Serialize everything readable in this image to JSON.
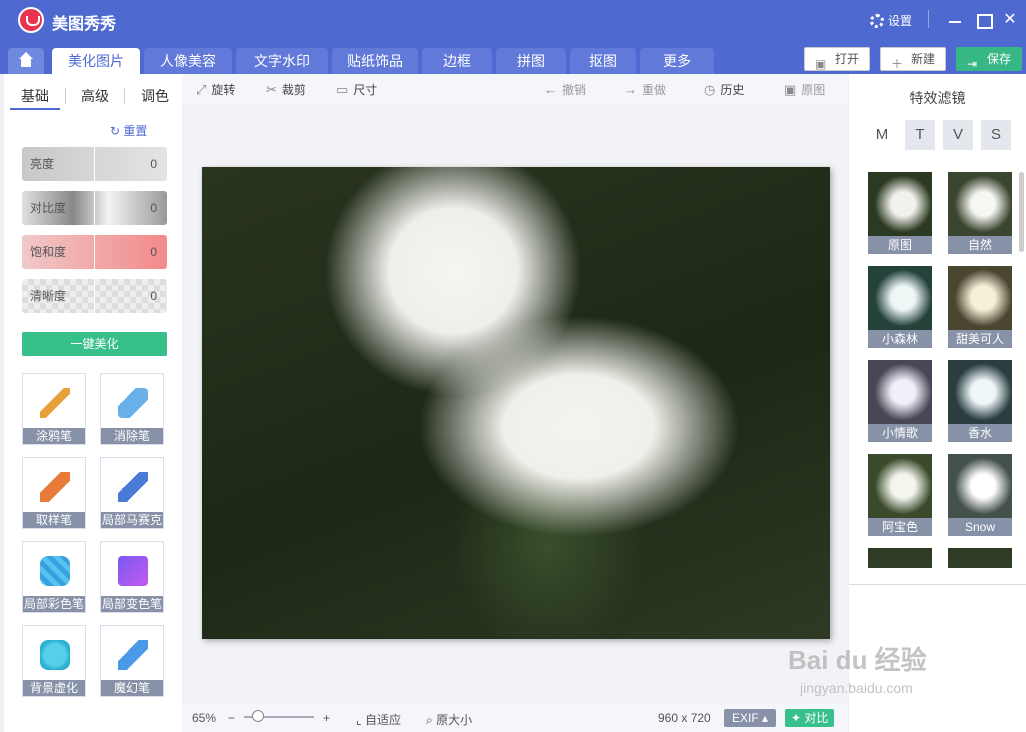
{
  "app": {
    "title": "美图秀秀",
    "settings_label": "设置",
    "close_glyph": "✕"
  },
  "tabs": [
    "美化图片",
    "人像美容",
    "文字水印",
    "贴纸饰品",
    "边框",
    "拼图",
    "抠图",
    "更多"
  ],
  "top_buttons": {
    "open": "打开",
    "new": "新建",
    "save": "保存"
  },
  "left_panel": {
    "subtabs": [
      "基础",
      "高级",
      "调色"
    ],
    "reset": "重置",
    "sliders": [
      {
        "label": "亮度",
        "value": "0"
      },
      {
        "label": "对比度",
        "value": "0"
      },
      {
        "label": "饱和度",
        "value": "0"
      },
      {
        "label": "清晰度",
        "value": "0"
      }
    ],
    "beautify": "一键美化",
    "tools": [
      {
        "label": "涂鸦笔",
        "icon": "brush-icon"
      },
      {
        "label": "消除笔",
        "icon": "eraser-icon"
      },
      {
        "label": "取样笔",
        "icon": "sampling-brush-icon"
      },
      {
        "label": "局部马赛克",
        "icon": "mosaic-brush-icon"
      },
      {
        "label": "局部彩色笔",
        "icon": "color-brush-icon"
      },
      {
        "label": "局部变色笔",
        "icon": "color-change-icon"
      },
      {
        "label": "背景虚化",
        "icon": "background-blur-icon"
      },
      {
        "label": "魔幻笔",
        "icon": "magic-brush-icon"
      }
    ]
  },
  "toolbar": {
    "rotate": "旋转",
    "crop": "裁剪",
    "size": "尺寸",
    "undo": "撤销",
    "redo": "重做",
    "history": "历史",
    "original": "原图"
  },
  "canvas": {
    "photo_subject": "white chrysanthemum photo"
  },
  "right_panel": {
    "title": "特效滤镜",
    "categories": [
      "M",
      "T",
      "V",
      "S"
    ],
    "filters": [
      "原图",
      "自然",
      "小森林",
      "甜美可人",
      "小情歌",
      "香水",
      "阿宝色",
      "Snow"
    ]
  },
  "statusbar": {
    "zoom": "65%",
    "minus": "−",
    "plus": "+",
    "fit": "自适应",
    "actual": "原大小",
    "dimensions": "960 x 720",
    "exif": "EXIF ▴",
    "compare": "对比"
  },
  "watermark": {
    "text": "Bai du 经验",
    "sub": "jingyan.baidu.com"
  },
  "colors": {
    "accent": "#4e6ad1",
    "green": "#37c08a",
    "label_bg": "#8791a8"
  }
}
